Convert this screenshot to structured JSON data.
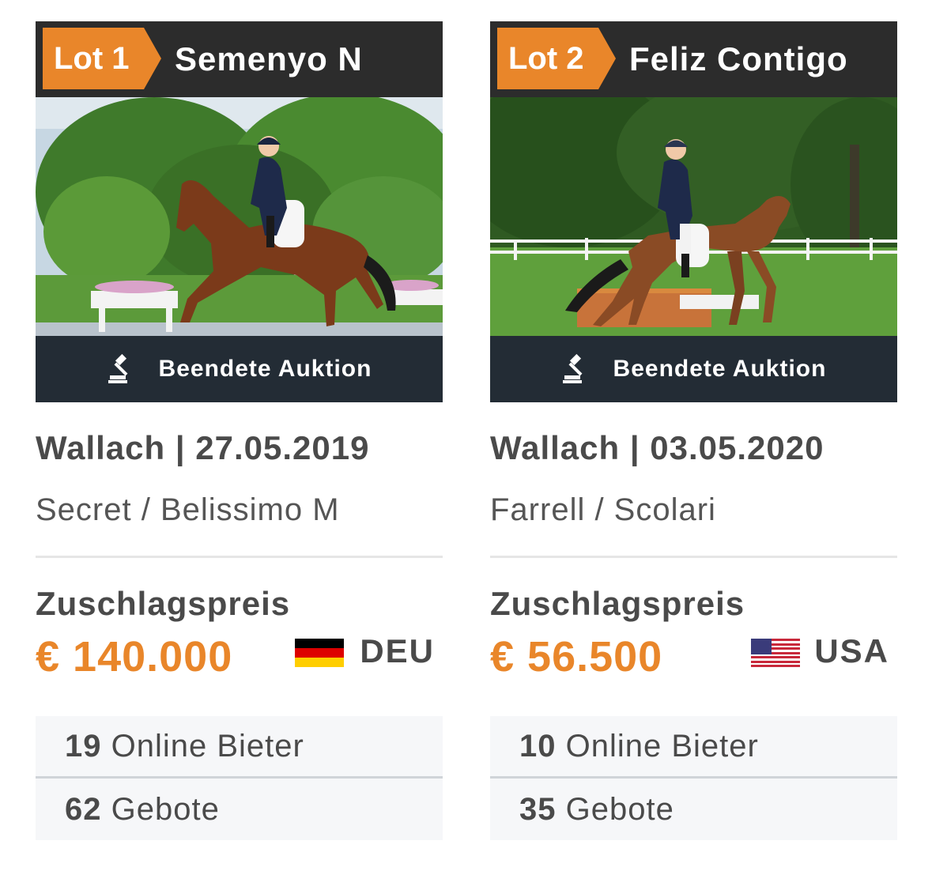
{
  "cards": [
    {
      "lot": "Lot 1",
      "name": "Semenyo N",
      "status": "Beendete Auktion",
      "meta": "Wallach | 27.05.2019",
      "pedigree": "Secret / Belissimo M",
      "price_label": "Zuschlagspreis",
      "price": "€ 140.000",
      "country": "DEU",
      "flag": "germany-flag",
      "bidders_count": "19",
      "bidders_label": "Online Bieter",
      "bids_count": "62",
      "bids_label": "Gebote"
    },
    {
      "lot": "Lot 2",
      "name": "Feliz Contigo",
      "status": "Beendete Auktion",
      "meta": "Wallach | 03.05.2020",
      "pedigree": "Farrell / Scolari",
      "price_label": "Zuschlagspreis",
      "price": "€ 56.500",
      "country": "USA",
      "flag": "usa-flag",
      "bidders_count": "10",
      "bidders_label": "Online Bieter",
      "bids_count": "35",
      "bids_label": "Gebote"
    }
  ],
  "colors": {
    "accent": "#e9862a",
    "header_bg": "#2c2c2c",
    "status_bg": "#232c35"
  },
  "icons": [
    "gavel-icon",
    "germany-flag",
    "usa-flag"
  ]
}
